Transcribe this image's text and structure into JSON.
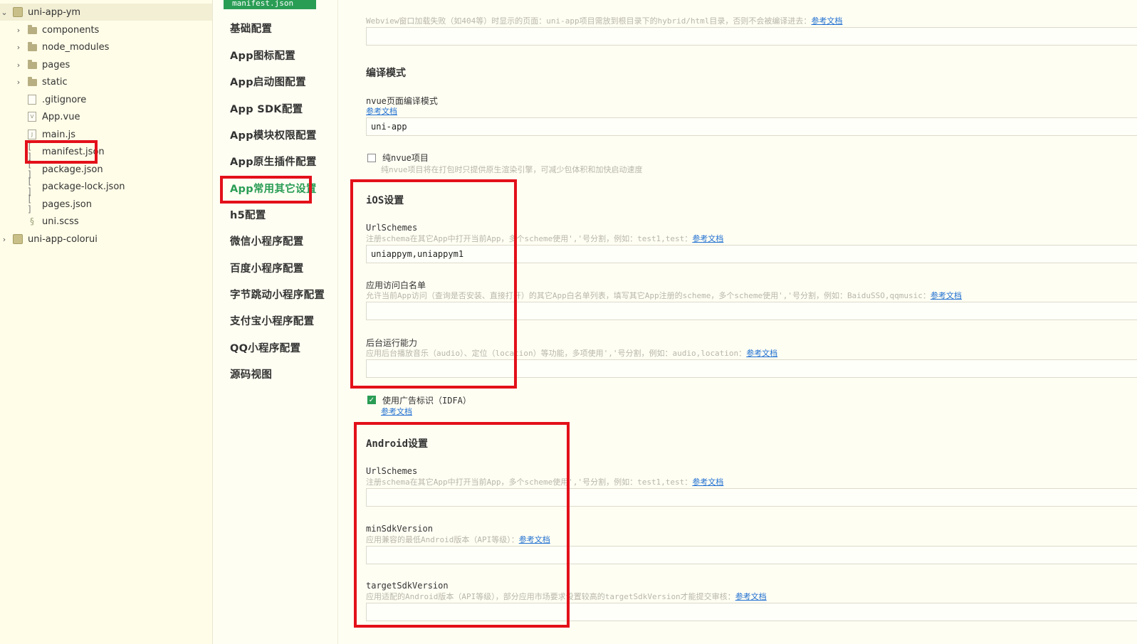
{
  "file_tree": {
    "items": [
      {
        "label": "uni-app-ym",
        "kind": "project",
        "chevron": "⌄"
      },
      {
        "label": "components",
        "kind": "folder",
        "chevron": "›"
      },
      {
        "label": "node_modules",
        "kind": "folder",
        "chevron": "›"
      },
      {
        "label": "pages",
        "kind": "folder",
        "chevron": "›"
      },
      {
        "label": "static",
        "kind": "folder",
        "chevron": "›"
      },
      {
        "label": ".gitignore",
        "kind": "file",
        "chevron": ""
      },
      {
        "label": "App.vue",
        "kind": "vue-file",
        "chevron": ""
      },
      {
        "label": "main.js",
        "kind": "js-file",
        "chevron": ""
      },
      {
        "label": "manifest.json",
        "kind": "json-file",
        "chevron": ""
      },
      {
        "label": "package.json",
        "kind": "json-file",
        "chevron": ""
      },
      {
        "label": "package-lock.json",
        "kind": "json-file",
        "chevron": ""
      },
      {
        "label": "pages.json",
        "kind": "json-file",
        "chevron": ""
      },
      {
        "label": "uni.scss",
        "kind": "scss-file",
        "chevron": ""
      },
      {
        "label": "uni-app-colorui",
        "kind": "project",
        "chevron": "›"
      }
    ]
  },
  "tab": {
    "label": "manifest.json"
  },
  "settings_nav": {
    "items": [
      "基础配置",
      "App图标配置",
      "App启动图配置",
      "App SDK配置",
      "App模块权限配置",
      "App原生插件配置",
      "App常用其它设置",
      "h5配置",
      "微信小程序配置",
      "百度小程序配置",
      "字节跳动小程序配置",
      "支付宝小程序配置",
      "QQ小程序配置",
      "源码视图"
    ],
    "active_index": 6
  },
  "main": {
    "webview_hint": "Webview窗口加载失败（如404等）时显示的页面：uni-app项目需放到根目录下的hybrid/html目录，否则不会被编译进去：",
    "webview_link": "参考文档",
    "webview_value": "",
    "compile": {
      "title": "编译模式",
      "nvue_label": "nvue页面编译模式",
      "nvue_link": "参考文档",
      "nvue_value": "uni-app",
      "pure_nvue_label": "纯nvue项目",
      "pure_nvue_hint": "纯nvue项目将在打包时只提供原生渲染引擎，可减少包体积和加快启动速度",
      "pure_nvue_checked": false
    },
    "ios": {
      "title": "iOS设置",
      "urlschemes_label": "UrlSchemes",
      "urlschemes_hint": "注册schema在其它App中打开当前App，多个scheme使用','号分割，例如：test1,test：",
      "urlschemes_link": "参考文档",
      "urlschemes_value": "uniappym,uniappym1",
      "whitelist_label": "应用访问白名单",
      "whitelist_hint": "允许当前App访问（查询是否安装、直接打开）的其它App白名单列表，填写其它App注册的scheme，多个scheme使用','号分割，例如：BaiduSSO,qqmusic：",
      "whitelist_link": "参考文档",
      "whitelist_value": "",
      "background_label": "后台运行能力",
      "background_hint": "应用后台播放音乐（audio）、定位（location）等功能，多项使用','号分割，例如：audio,location：",
      "background_link": "参考文档",
      "background_value": "",
      "idfa_label": "使用广告标识（IDFA）",
      "idfa_link": "参考文档",
      "idfa_checked": true,
      "check_glyph": "✓"
    },
    "android": {
      "title": "Android设置",
      "urlschemes_label": "UrlSchemes",
      "urlschemes_hint": "注册schema在其它App中打开当前App，多个scheme使用','号分割，例如：test1,test：",
      "urlschemes_link": "参考文档",
      "urlschemes_value": "",
      "minsdk_label": "minSdkVersion",
      "minsdk_hint": "应用兼容的最低Android版本（API等级）：",
      "minsdk_link": "参考文档",
      "minsdk_value": "",
      "targetsdk_label": "targetSdkVersion",
      "targetsdk_hint": "应用适配的Android版本（API等级），部分应用市场要求设置较高的targetSdkVersion才能提交审核：",
      "targetsdk_link": "参考文档",
      "targetsdk_value": ""
    }
  },
  "colors": {
    "accent": "#2a9d55",
    "highlight": "#e3101a",
    "link": "#1f6fd1",
    "background": "#fffef3"
  }
}
